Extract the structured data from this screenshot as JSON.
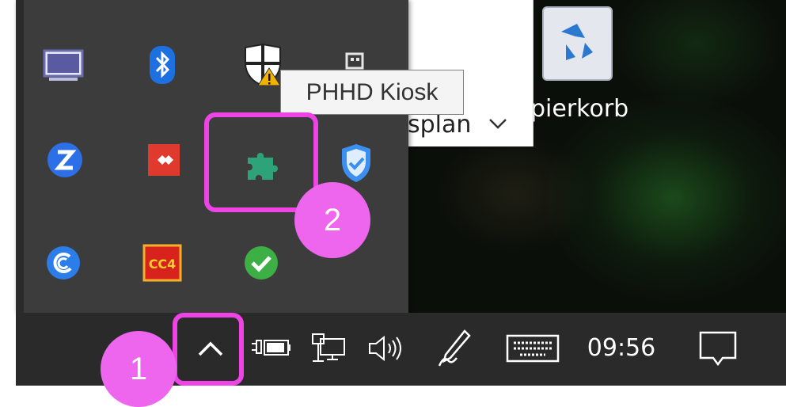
{
  "desktop": {
    "recycle_bin_label": "pierkorb"
  },
  "background_window": {
    "text": "splan",
    "dropdown_icon": "chevron-down-icon"
  },
  "tooltip": {
    "text": "PHHD Kiosk"
  },
  "tray_overflow": {
    "icons": [
      "display-icon",
      "bluetooth-icon",
      "security-warning-shield-icon",
      "usb-drive-icon",
      "zoom-icon",
      "anydesk-icon",
      "puzzle-piece-icon",
      "defender-shield-icon",
      "cloud-sync-icon",
      "cc4-icon",
      "checkmark-icon"
    ]
  },
  "taskbar": {
    "show_hidden_icons": "chevron-up-icon",
    "battery": "battery-charging-icon",
    "network": "network-icon",
    "volume": "volume-icon",
    "pen": "pen-icon",
    "touch_keyboard": "keyboard-icon",
    "clock": "09:56",
    "notifications": "notification-icon"
  },
  "annotations": {
    "step1": "1",
    "step2": "2",
    "highlight_color": "#ee44e6"
  }
}
